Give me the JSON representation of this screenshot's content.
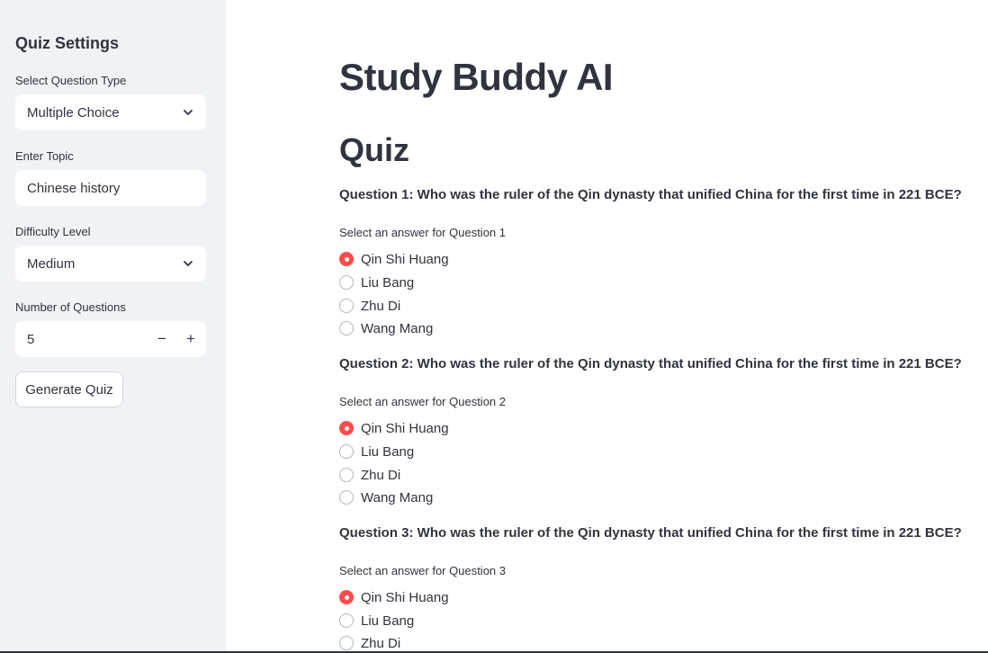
{
  "sidebar": {
    "title": "Quiz Settings",
    "question_type": {
      "label": "Select Question Type",
      "value": "Multiple Choice"
    },
    "topic": {
      "label": "Enter Topic",
      "value": "Chinese history"
    },
    "difficulty": {
      "label": "Difficulty Level",
      "value": "Medium"
    },
    "num_questions": {
      "label": "Number of Questions",
      "value": "5",
      "minus": "−",
      "plus": "+"
    },
    "generate_label": "Generate Quiz"
  },
  "main": {
    "title": "Study Buddy AI",
    "subtitle": "Quiz",
    "questions": [
      {
        "text": "Question 1: Who was the ruler of the Qin dynasty that unified China for the first time in 221 BCE?",
        "prompt": "Select an answer for Question 1",
        "options": [
          "Qin Shi Huang",
          "Liu Bang",
          "Zhu Di",
          "Wang Mang"
        ],
        "selected": 0
      },
      {
        "text": "Question 2: Who was the ruler of the Qin dynasty that unified China for the first time in 221 BCE?",
        "prompt": "Select an answer for Question 2",
        "options": [
          "Qin Shi Huang",
          "Liu Bang",
          "Zhu Di",
          "Wang Mang"
        ],
        "selected": 0
      },
      {
        "text": "Question 3: Who was the ruler of the Qin dynasty that unified China for the first time in 221 BCE?",
        "prompt": "Select an answer for Question 3",
        "options": [
          "Qin Shi Huang",
          "Liu Bang",
          "Zhu Di"
        ],
        "selected": 0
      }
    ]
  },
  "colors": {
    "accent": "#ff4b4b",
    "sidebar_bg": "#f0f2f6",
    "text": "#31333f"
  }
}
